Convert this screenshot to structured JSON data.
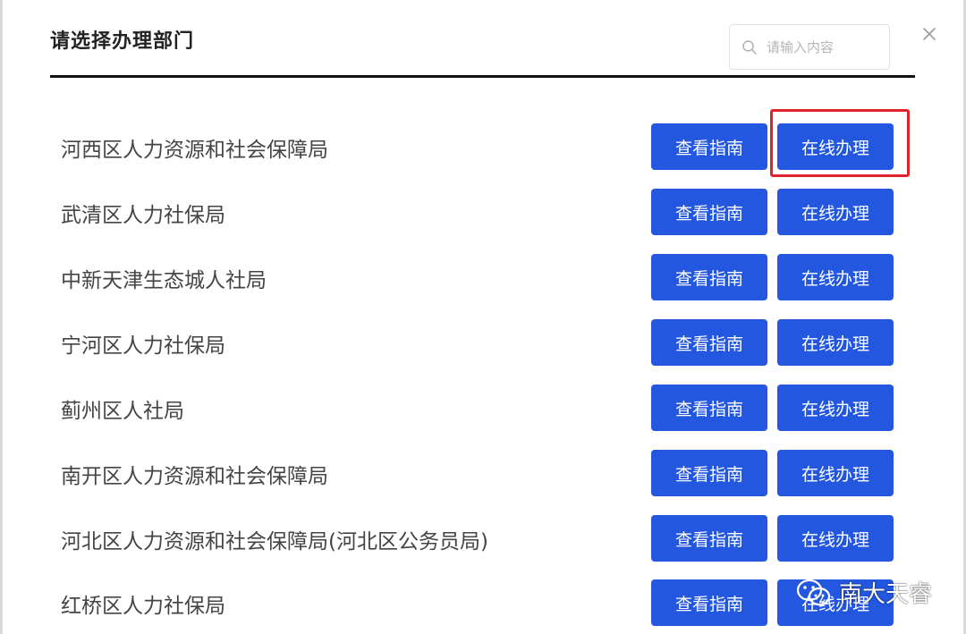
{
  "dialog": {
    "title": "请选择办理部门",
    "search_placeholder": "请输入内容",
    "close_label": "×"
  },
  "departments": [
    {
      "name": "河西区人力资源和社会保障局",
      "guide_label": "查看指南",
      "online_label": "在线办理"
    },
    {
      "name": "武清区人力社保局",
      "guide_label": "查看指南",
      "online_label": "在线办理"
    },
    {
      "name": "中新天津生态城人社局",
      "guide_label": "查看指南",
      "online_label": "在线办理"
    },
    {
      "name": "宁河区人力社保局",
      "guide_label": "查看指南",
      "online_label": "在线办理"
    },
    {
      "name": "蓟州区人社局",
      "guide_label": "查看指南",
      "online_label": "在线办理"
    },
    {
      "name": "南开区人力资源和社会保障局",
      "guide_label": "查看指南",
      "online_label": "在线办理"
    },
    {
      "name": "河北区人力资源和社会保障局(河北区公务员局)",
      "guide_label": "查看指南",
      "online_label": "在线办理"
    },
    {
      "name": "红桥区人力社保局",
      "guide_label": "查看指南",
      "online_label": "在线办理"
    }
  ],
  "watermark": {
    "text": "南大天睿",
    "icon": "wechat-icon"
  },
  "colors": {
    "button": "#2357e0",
    "highlight": "#e0232a",
    "divider": "#111111"
  }
}
